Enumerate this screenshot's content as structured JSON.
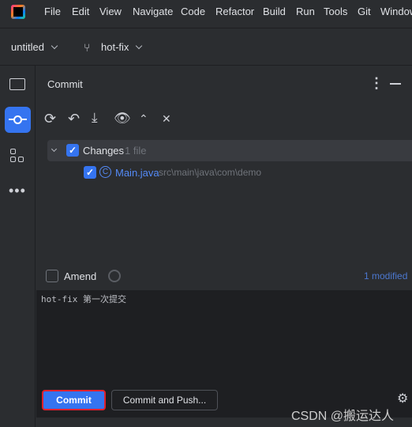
{
  "menubar": {
    "items": [
      "File",
      "Edit",
      "View",
      "Navigate",
      "Code",
      "Refactor",
      "Build",
      "Run",
      "Tools",
      "Git",
      "Window"
    ]
  },
  "toolbar": {
    "project": "untitled",
    "branch": "hot-fix"
  },
  "panel": {
    "title": "Commit"
  },
  "changes": {
    "label": "Changes",
    "count": "1 file",
    "files": [
      {
        "name": "Main.java",
        "path": "src\\main\\java\\com\\demo"
      }
    ]
  },
  "amend": {
    "label": "Amend",
    "status": "1 modified"
  },
  "message": "hot-fix 第一次提交",
  "buttons": {
    "commit": "Commit",
    "commit_push": "Commit and Push..."
  },
  "watermark": "CSDN @搬运达人",
  "colors": {
    "accent": "#3574f0",
    "highlight": "#e0202c"
  }
}
